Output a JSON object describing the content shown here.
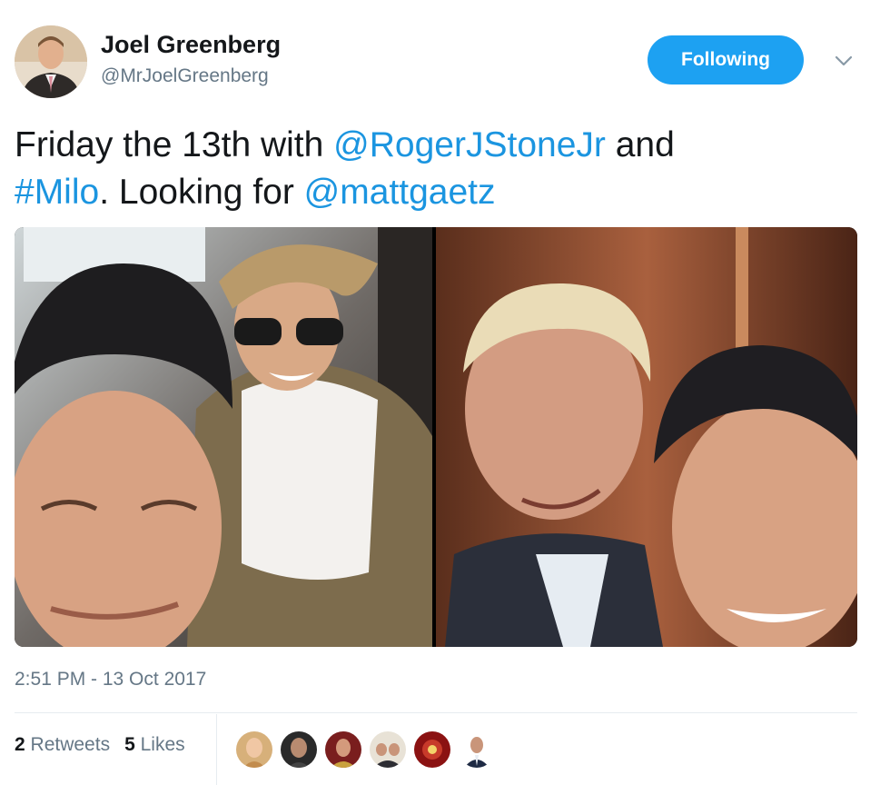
{
  "author": {
    "display_name": "Joel Greenberg",
    "handle": "@MrJoelGreenberg",
    "avatar_icon": "profile-photo"
  },
  "follow_button": {
    "label": "Following",
    "color": "#1da1f2"
  },
  "menu": {
    "icon": "chevron-down-icon"
  },
  "tweet": {
    "text_1": "Friday the 13th with ",
    "mention_1": "@RogerJStoneJr",
    "text_2": " and ",
    "hashtag": "#Milo",
    "text_3": ". Looking for ",
    "mention_2": "@mattgaetz",
    "link_color": "#1b95e0"
  },
  "photos": [
    {
      "description": "photo-1"
    },
    {
      "description": "photo-2"
    }
  ],
  "timestamp": "2:51 PM - 13 Oct 2017",
  "stats": {
    "retweets_count": "2",
    "retweets_label": "Retweets",
    "likes_count": "5",
    "likes_label": "Likes"
  },
  "likers_count_shown": 6
}
